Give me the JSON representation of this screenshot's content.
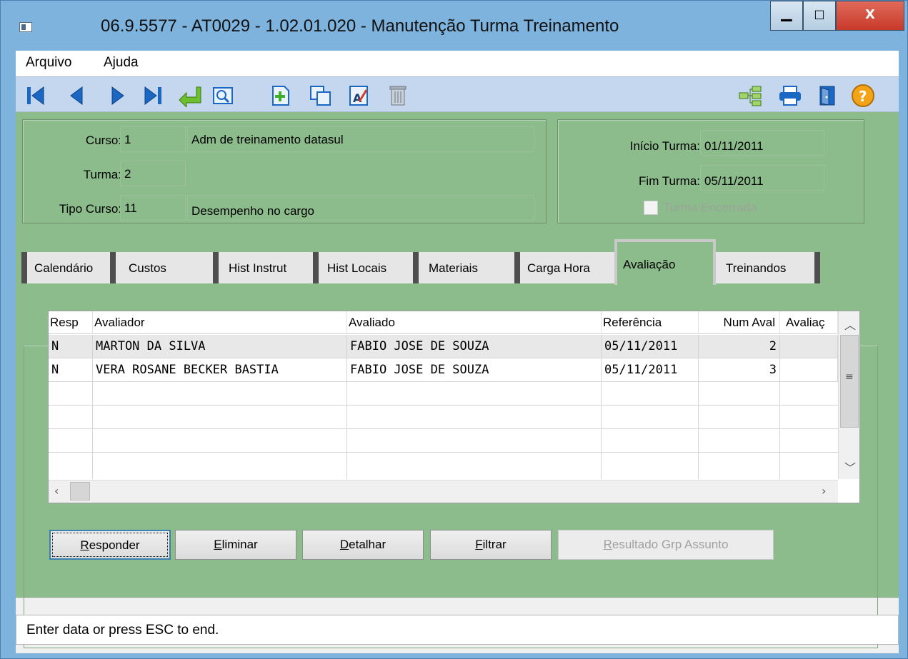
{
  "window": {
    "title": "06.9.5577 - AT0029 - 1.02.01.020 - Manutenção Turma Treinamento",
    "min_glyph": "▁",
    "max_glyph": "□",
    "close_glyph": "X"
  },
  "menu": {
    "file": "Arquivo",
    "help": "Ajuda"
  },
  "toolbar": {
    "icons": [
      "first-icon",
      "prev-icon",
      "next-icon",
      "last-icon",
      "goto-icon",
      "search-icon",
      "add-icon",
      "copy-icon",
      "edit-icon",
      "delete-icon",
      "tree-icon",
      "print-icon",
      "exit-icon",
      "help-icon"
    ]
  },
  "header": {
    "curso_label": "Curso:",
    "curso_code": "1",
    "curso_desc": "Adm de treinamento datasul",
    "turma_label": "Turma:",
    "turma_code": "2",
    "tipo_label": "Tipo Curso:",
    "tipo_code": "11",
    "tipo_desc": "Desempenho no cargo",
    "inicio_label": "Início Turma:",
    "inicio_value": "01/11/2011",
    "fim_label": "Fim Turma:",
    "fim_value": "05/11/2011",
    "encerrada_label": "Turma Encerrada"
  },
  "tabs": [
    "Calendário",
    "Custos",
    "Hist Instrut",
    "Hist Locais",
    "Materiais",
    "Carga Hora",
    "Avaliação",
    "Treinandos"
  ],
  "grid": {
    "columns": [
      "Resp",
      "Avaliador",
      "Avaliado",
      "Referência",
      "Num Aval",
      "Avaliaç"
    ],
    "rows": [
      [
        "N",
        "MARTON DA SILVA",
        "FABIO JOSE DE SOUZA",
        "05/11/2011",
        "2",
        ""
      ],
      [
        "N",
        "VERA ROSANE BECKER BASTIA",
        "FABIO JOSE DE SOUZA",
        "05/11/2011",
        "3",
        ""
      ]
    ]
  },
  "buttons": {
    "responder": {
      "key": "R",
      "rest": "esponder"
    },
    "eliminar": {
      "key": "E",
      "rest": "liminar"
    },
    "detalhar": {
      "key": "D",
      "rest": "etalhar"
    },
    "filtrar": {
      "key": "F",
      "rest": "iltrar"
    },
    "resultado": {
      "key": "R",
      "rest": "esultado Grp Assunto"
    }
  },
  "status": "Enter data or press ESC to end.",
  "colors": {
    "form_bg": "#8cbb8c",
    "toolbar_bg": "#c5d7ee",
    "window_frame": "#7eb3dd"
  }
}
